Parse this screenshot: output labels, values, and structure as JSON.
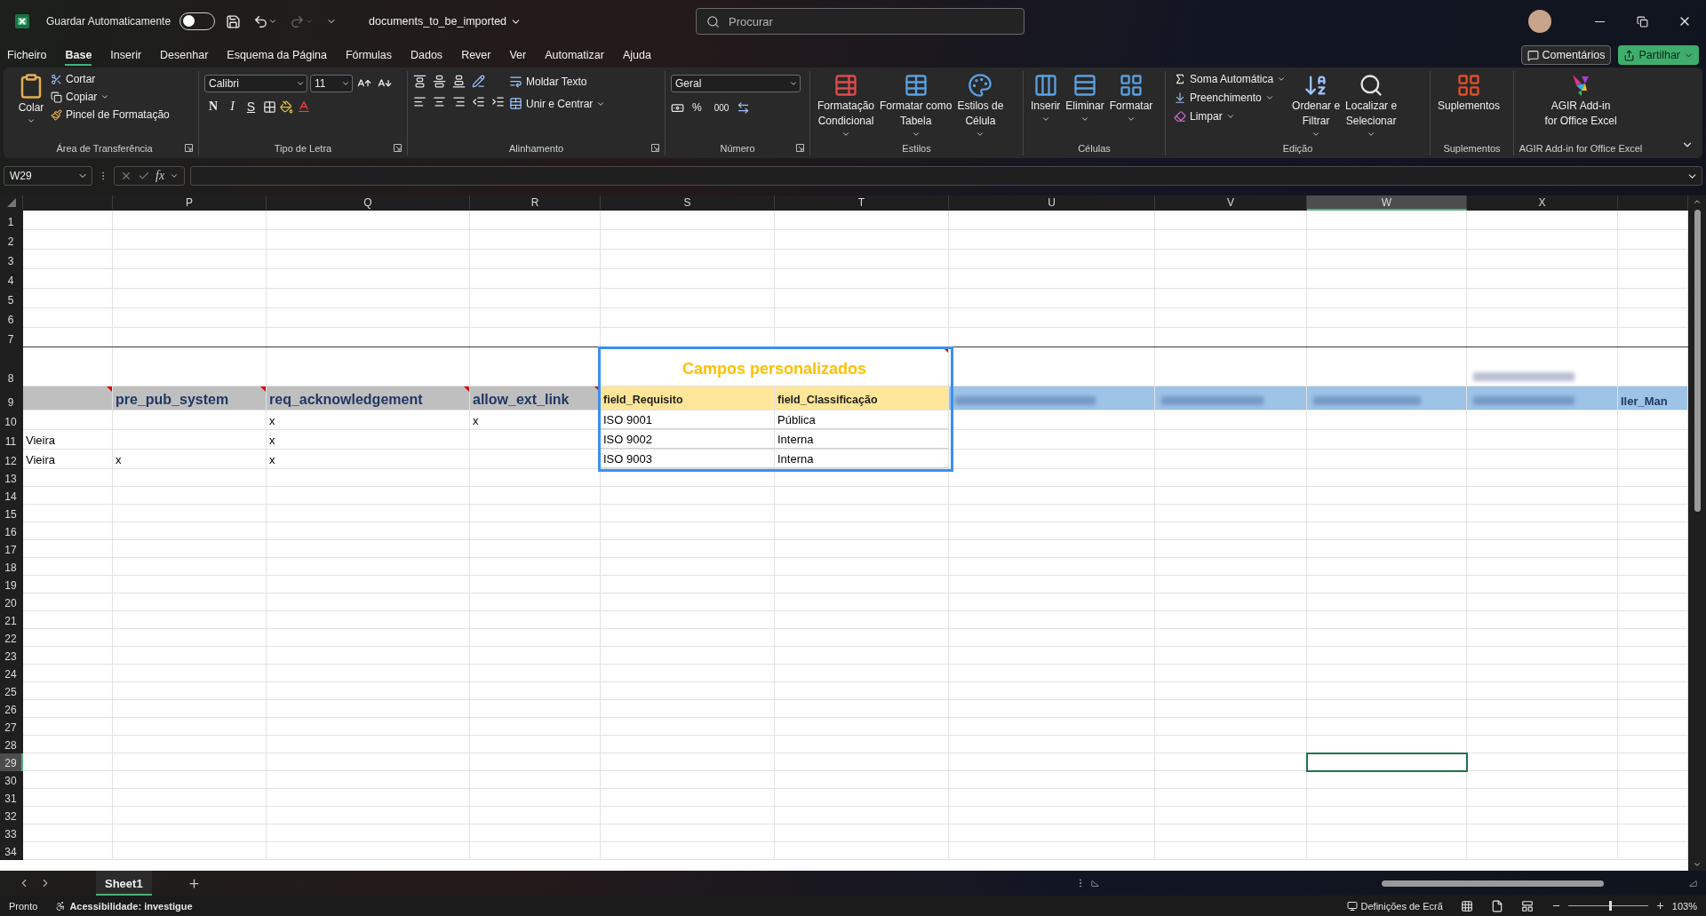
{
  "title_bar": {
    "autosave_label": "Guardar Automaticamente",
    "autosave_on": false,
    "file_name": "documents_to_be_imported",
    "search_placeholder": "Procurar"
  },
  "menu_tabs": [
    {
      "label": "Ficheiro",
      "selected": false
    },
    {
      "label": "Base",
      "selected": true
    },
    {
      "label": "Inserir",
      "selected": false
    },
    {
      "label": "Desenhar",
      "selected": false
    },
    {
      "label": "Esquema da Página",
      "selected": false
    },
    {
      "label": "Fórmulas",
      "selected": false
    },
    {
      "label": "Dados",
      "selected": false
    },
    {
      "label": "Rever",
      "selected": false
    },
    {
      "label": "Ver",
      "selected": false
    },
    {
      "label": "Automatizar",
      "selected": false
    },
    {
      "label": "Ajuda",
      "selected": false
    }
  ],
  "header_buttons": {
    "comments": "Comentários",
    "share": "Partilhar"
  },
  "ribbon": {
    "clipboard": {
      "label": "Área de Transferência",
      "paste": "Colar",
      "cut": "Cortar",
      "copy": "Copiar",
      "format_painter": "Pincel de Formatação"
    },
    "font": {
      "label": "Tipo de Letra",
      "font_name": "Calibri",
      "font_size": "11",
      "bold": "N",
      "italic": "I",
      "underline": "S"
    },
    "alignment": {
      "label": "Alinhamento",
      "wrap_text": "Moldar Texto",
      "merge_center": "Unir e Centrar"
    },
    "number": {
      "label": "Número",
      "format": "Geral",
      "percent": "%",
      "thousands": "000"
    },
    "styles": {
      "label": "Estilos",
      "buttons": [
        {
          "lines": [
            "Formatação",
            "Condicional"
          ]
        },
        {
          "lines": [
            "Formatar como",
            "Tabela"
          ]
        },
        {
          "lines": [
            "Estilos de",
            "Célula"
          ]
        }
      ]
    },
    "cells": {
      "label": "Células",
      "buttons": [
        {
          "lines": [
            "Inserir"
          ]
        },
        {
          "lines": [
            "Eliminar"
          ]
        },
        {
          "lines": [
            "Formatar"
          ]
        }
      ]
    },
    "editing": {
      "label": "Edição",
      "autosum": "Soma Automática",
      "fill": "Preenchimento",
      "clear": "Limpar",
      "sort": [
        "Ordenar e",
        "Filtrar"
      ],
      "find": [
        "Localizar e",
        "Selecionar"
      ]
    },
    "addins": {
      "label": "Suplementos",
      "button": "Suplementos"
    },
    "agir": {
      "label": "AGIR Add-in for Office Excel",
      "lines": [
        "AGIR Add-in",
        "for Office Excel"
      ]
    }
  },
  "formula_bar": {
    "name_box": "W29",
    "fx": "fx"
  },
  "sheet": {
    "columns": [
      {
        "selected": false
      },
      {
        "letter": "P",
        "selected": false
      },
      {
        "letter": "Q",
        "selected": false
      },
      {
        "letter": "R",
        "selected": false
      },
      {
        "letter": "S",
        "selected": false
      },
      {
        "letter": "T",
        "selected": false
      },
      {
        "letter": "U",
        "selected": false
      },
      {
        "letter": "V",
        "selected": false
      },
      {
        "letter": "W",
        "selected": true
      },
      {
        "letter": "X",
        "selected": false
      },
      {
        "selected": false
      }
    ],
    "rows": [
      {
        "number": "1",
        "kind": "top",
        "selected": false
      },
      {
        "number": "2",
        "kind": "top",
        "selected": false
      },
      {
        "number": "3",
        "kind": "top",
        "selected": false
      },
      {
        "number": "4",
        "kind": "top",
        "selected": false
      },
      {
        "number": "5",
        "kind": "top",
        "selected": false
      },
      {
        "number": "6",
        "kind": "top",
        "selected": false
      },
      {
        "number": "7",
        "kind": "rule",
        "selected": false
      },
      {
        "number": "8",
        "kind": "title",
        "selected": false,
        "cells": [
          {},
          {},
          {},
          {},
          {
            "text": "Campos personalizados",
            "kind": "title",
            "comment": true
          },
          {},
          {},
          {},
          {},
          {
            "redacted": true
          },
          {}
        ]
      },
      {
        "number": "9",
        "kind": "header",
        "selected": false,
        "cells": [
          {
            "kind": "grey",
            "comment": true
          },
          {
            "text": "pre_pub_system",
            "kind": "grey",
            "comment": true
          },
          {
            "text": "req_acknowledgement",
            "kind": "grey",
            "comment": true
          },
          {
            "text": "allow_ext_link",
            "kind": "grey",
            "comment": true
          },
          {
            "text": "field_Requisito",
            "kind": "yellow"
          },
          {
            "text": "field_Classificação",
            "kind": "yellow"
          },
          {
            "kind": "blue",
            "redacted": true
          },
          {
            "kind": "blue",
            "redacted": true
          },
          {
            "kind": "blue",
            "redacted": true
          },
          {
            "kind": "blue",
            "redacted": true
          },
          {
            "text": "ller_Man",
            "kind": "blue"
          }
        ]
      },
      {
        "number": "10",
        "kind": "data",
        "selected": false,
        "cells": [
          {},
          {},
          {
            "text": "x"
          },
          {
            "text": "x"
          },
          {
            "text": "ISO 9001"
          },
          {
            "text": "Pública"
          },
          {},
          {},
          {},
          {},
          {}
        ]
      },
      {
        "number": "11",
        "kind": "data",
        "selected": false,
        "cells": [
          {
            "text": "Vieira"
          },
          {},
          {
            "text": "x"
          },
          {},
          {
            "text": "ISO 9002"
          },
          {
            "text": "Interna"
          },
          {},
          {},
          {},
          {},
          {}
        ]
      },
      {
        "number": "12",
        "kind": "data",
        "selected": false,
        "cells": [
          {
            "text": "Vieira"
          },
          {
            "text": "x"
          },
          {
            "text": "x"
          },
          {},
          {
            "text": "ISO 9003"
          },
          {
            "text": "Interna"
          },
          {},
          {},
          {},
          {},
          {}
        ]
      },
      {
        "number": "13",
        "kind": "plain",
        "selected": false
      },
      {
        "number": "14",
        "kind": "plain",
        "selected": false
      },
      {
        "number": "15",
        "kind": "plain",
        "selected": false
      },
      {
        "number": "16",
        "kind": "plain",
        "selected": false
      },
      {
        "number": "17",
        "kind": "plain",
        "selected": false
      },
      {
        "number": "18",
        "kind": "plain",
        "selected": false
      },
      {
        "number": "19",
        "kind": "plain",
        "selected": false
      },
      {
        "number": "20",
        "kind": "plain",
        "selected": false
      },
      {
        "number": "21",
        "kind": "plain",
        "selected": false
      },
      {
        "number": "22",
        "kind": "plain",
        "selected": false
      },
      {
        "number": "23",
        "kind": "plain",
        "selected": false
      },
      {
        "number": "24",
        "kind": "plain",
        "selected": false
      },
      {
        "number": "25",
        "kind": "plain",
        "selected": false
      },
      {
        "number": "26",
        "kind": "plain",
        "selected": false
      },
      {
        "number": "27",
        "kind": "plain",
        "selected": false
      },
      {
        "number": "28",
        "kind": "plain",
        "selected": false
      },
      {
        "number": "29",
        "kind": "plain",
        "selected": true
      },
      {
        "number": "30",
        "kind": "plain",
        "selected": false
      },
      {
        "number": "31",
        "kind": "plain",
        "selected": false
      },
      {
        "number": "32",
        "kind": "plain",
        "selected": false
      },
      {
        "number": "33",
        "kind": "plain",
        "selected": false
      },
      {
        "number": "34",
        "kind": "plain",
        "selected": false
      }
    ]
  },
  "sheet_tabs": [
    {
      "label": "Sheet1",
      "selected": true
    }
  ],
  "status_bar": {
    "ready": "Pronto",
    "accessibility": "Acessibilidade: investigue",
    "display_settings": "Definições de Ecrã",
    "zoom": "103%",
    "zoom_level": {
      "level": 0.52
    }
  }
}
